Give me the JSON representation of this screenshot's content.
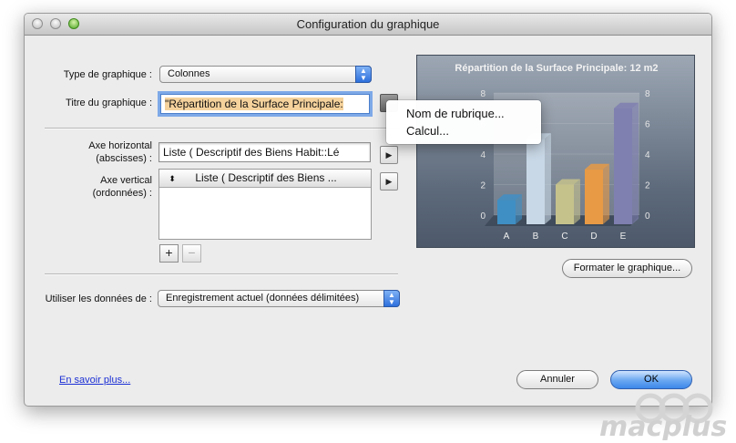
{
  "window": {
    "title": "Configuration du graphique"
  },
  "form": {
    "chart_type": {
      "label": "Type de graphique :",
      "value": "Colonnes"
    },
    "chart_title": {
      "label": "Titre du graphique :",
      "value_selected": "\"Répartition de la Surface Principale:"
    },
    "x_axis": {
      "label_line1": "Axe horizontal",
      "label_line2": "(abscisses) :",
      "value": "Liste ( Descriptif des Biens Habit::Lé"
    },
    "y_axis": {
      "label_line1": "Axe vertical",
      "label_line2": "(ordonnées) :",
      "header_value": "Liste ( Descriptif des Biens ..."
    },
    "add_label": "+",
    "remove_label": "−",
    "use_data": {
      "label": "Utiliser les données de :",
      "value": "Enregistrement actuel (données délimitées)"
    }
  },
  "context_menu": {
    "items": [
      "Nom de rubrique...",
      "Calcul..."
    ]
  },
  "chart_data": {
    "type": "bar",
    "title": "Répartition de la Surface Principale: 12 m2",
    "categories": [
      "A",
      "B",
      "C",
      "D",
      "E"
    ],
    "values": [
      1,
      5,
      2,
      3,
      7
    ],
    "ylim": [
      0,
      8
    ],
    "y_ticks": [
      "0",
      "2",
      "4",
      "6",
      "8"
    ],
    "bar_colors": [
      "#3f8fc4",
      "#c9d8e6",
      "#c6c28c",
      "#e89a45",
      "#7f7fb0"
    ]
  },
  "buttons": {
    "format_chart": "Formater le graphique...",
    "cancel": "Annuler",
    "ok": "OK",
    "learn_more": "En savoir plus..."
  },
  "watermark": {
    "text": "macplus"
  }
}
